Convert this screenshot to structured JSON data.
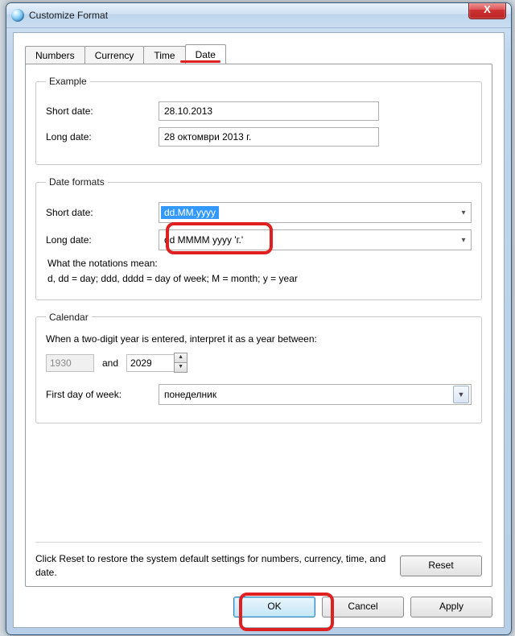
{
  "window": {
    "title": "Customize Format"
  },
  "tabs": {
    "numbers": "Numbers",
    "currency": "Currency",
    "time": "Time",
    "date": "Date"
  },
  "example": {
    "legend": "Example",
    "short_label": "Short date:",
    "short_value": "28.10.2013",
    "long_label": "Long date:",
    "long_value": "28 октомври 2013 г."
  },
  "formats": {
    "legend": "Date formats",
    "short_label": "Short date:",
    "short_value": "dd.MM.yyyy",
    "long_label": "Long date:",
    "long_value": "dd MMMM yyyy 'г.'",
    "notation_header": "What the notations mean:",
    "notation_body": "d, dd = day;  ddd, dddd = day of week;  M = month;  y = year"
  },
  "calendar": {
    "legend": "Calendar",
    "two_digit_label": "When a two-digit year is entered, interpret it as a year between:",
    "year_from": "1930",
    "and": "and",
    "year_to": "2029",
    "first_day_label": "First day of week:",
    "first_day_value": "понеделник"
  },
  "reset": {
    "msg": "Click Reset to restore the system default settings for numbers, currency, time, and date.",
    "btn": "Reset"
  },
  "buttons": {
    "ok": "OK",
    "cancel": "Cancel",
    "apply": "Apply"
  }
}
